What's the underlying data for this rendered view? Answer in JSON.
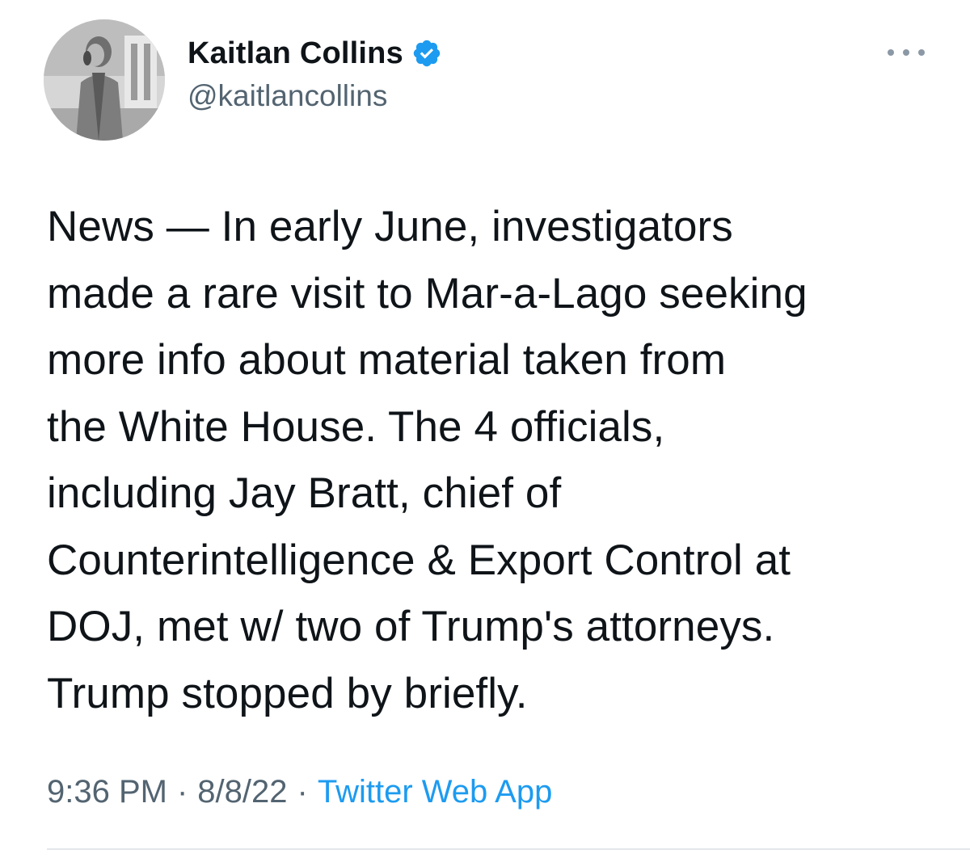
{
  "author": {
    "display_name": "Kaitlan Collins",
    "handle": "@kaitlancollins",
    "verified": true,
    "avatar_icon": "profile-photo"
  },
  "menu": {
    "icon": "more-horizontal-icon"
  },
  "tweet": {
    "lines": [
      "News — In early June, investigators",
      "made a rare visit to Mar-a-Lago seeking",
      "more info about material taken from",
      "the White House. The 4 officials,",
      "including Jay Bratt, chief of",
      "Counterintelligence & Export Control at",
      "DOJ, met w/ two of Trump's attorneys.",
      "Trump stopped by briefly."
    ],
    "time": "9:36 PM",
    "separator": "·",
    "date": "8/8/22",
    "source": "Twitter Web App"
  },
  "colors": {
    "text_primary": "#0f1419",
    "text_secondary": "#536471",
    "link_blue": "#1d9bf0",
    "verified_blue": "#1d9bf0"
  }
}
